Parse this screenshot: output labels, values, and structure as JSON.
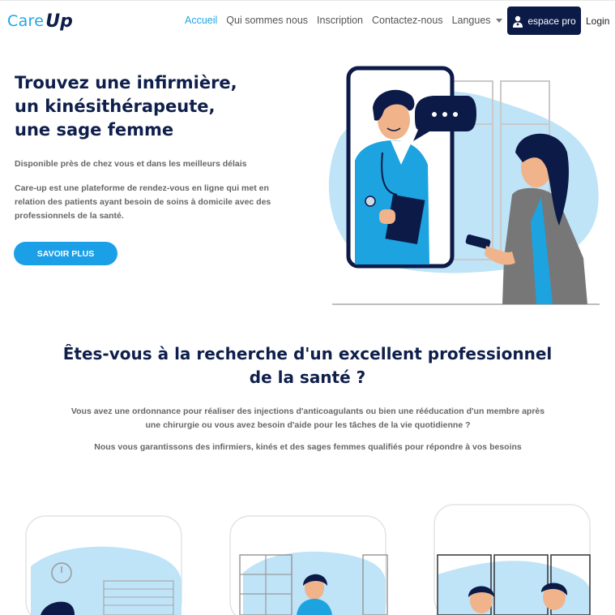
{
  "brand": {
    "logo_part1": "Care",
    "logo_part2": "Up",
    "accent": "#1fa6e6",
    "navy": "#0c1a47"
  },
  "nav": {
    "items": [
      {
        "label": "Accueil",
        "active": true
      },
      {
        "label": "Qui sommes nous",
        "active": false
      },
      {
        "label": "Inscription",
        "active": false
      },
      {
        "label": "Contactez-nous",
        "active": false
      },
      {
        "label": "Langues",
        "active": false,
        "dropdown": true
      }
    ],
    "pro_button": "espace pro",
    "login": "Login"
  },
  "hero": {
    "title_lines": [
      "Trouvez une infirmière,",
      "un kinésithérapeute,",
      "une sage femme"
    ],
    "subtitle": "Disponible près de chez vous et dans les meilleurs délais",
    "description": "Care-up est une plateforme de rendez-vous en ligne qui met en relation des patients ayant besoin de soins à domicile avec des professionnels de la santé.",
    "cta": "SAVOIR PLUS"
  },
  "section2": {
    "title_line1": "Êtes-vous à la recherche d'un excellent professionnel",
    "title_line2": "de la santé ?",
    "p1_line1": "Vous avez une ordonnance pour réaliser des injections d'anticoagulants ou bien une rééducation d'un membre après",
    "p1_line2": "une chirurgie ou vous avez besoin d'aide pour les tâches de la vie quotidienne ?",
    "p2": "Nous vous garantissons des infirmiers, kinés et des sages femmes qualifiés pour répondre à vos besoins"
  },
  "icons": [
    "doctor-icon",
    "caret-down-icon",
    "chat-bubble-icon",
    "phone-icon"
  ]
}
